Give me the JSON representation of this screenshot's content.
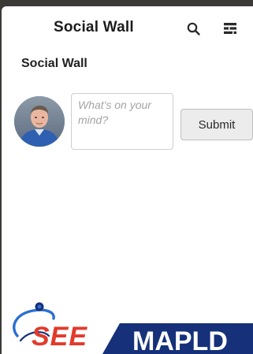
{
  "header": {
    "title": "Social Wall",
    "search_icon": "search-icon",
    "menu_icon": "menu-icon"
  },
  "section": {
    "title": "Social Wall"
  },
  "composer": {
    "placeholder": "What's on your mind?",
    "value": "",
    "submit_label": "Submit"
  },
  "logo": {
    "left_text": "SEE",
    "right_text": "MAPLD"
  },
  "colors": {
    "title": "#1c1c1c",
    "brand_red": "#e23a2a",
    "brand_navy": "#16317a",
    "brand_blue": "#2a6fd1"
  }
}
